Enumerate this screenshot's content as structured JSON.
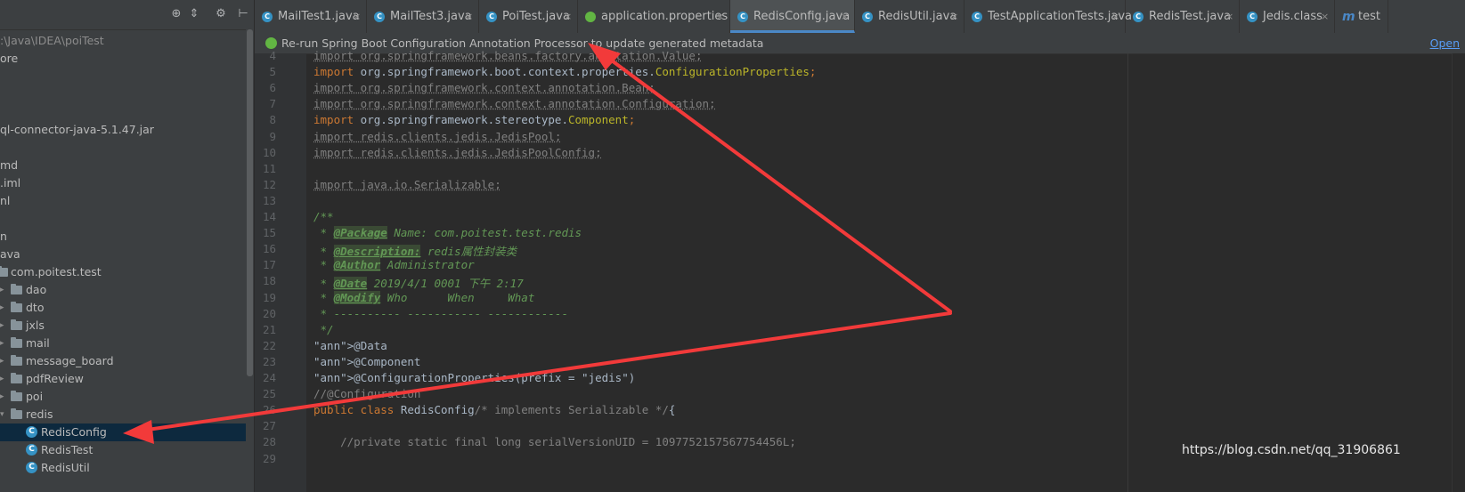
{
  "sidebar": {
    "toolbar_icons": [
      "target-icon",
      "collapse-icon",
      "gear-icon",
      "hide-icon"
    ],
    "items": [
      {
        "label": ":\\Java\\IDEA\\poiTest",
        "kind": "path"
      },
      {
        "label": "ore",
        "kind": "text"
      },
      {
        "label": "",
        "kind": "text"
      },
      {
        "label": "",
        "kind": "text"
      },
      {
        "label": "",
        "kind": "text"
      },
      {
        "label": "ql-connector-java-5.1.47.jar",
        "kind": "text"
      },
      {
        "label": "",
        "kind": "text"
      },
      {
        "label": "md",
        "kind": "text"
      },
      {
        "label": ".iml",
        "kind": "text"
      },
      {
        "label": "nl",
        "kind": "text"
      },
      {
        "label": "",
        "kind": "text"
      },
      {
        "label": "n",
        "kind": "text"
      },
      {
        "label": "ava",
        "kind": "text"
      },
      {
        "label": "com.poitest.test",
        "kind": "package"
      },
      {
        "label": "dao",
        "kind": "folder"
      },
      {
        "label": "dto",
        "kind": "folder"
      },
      {
        "label": "jxls",
        "kind": "folder"
      },
      {
        "label": "mail",
        "kind": "folder"
      },
      {
        "label": "message_board",
        "kind": "folder"
      },
      {
        "label": "pdfReview",
        "kind": "folder"
      },
      {
        "label": "poi",
        "kind": "folder"
      },
      {
        "label": "redis",
        "kind": "folder-open"
      },
      {
        "label": "RedisConfig",
        "kind": "class",
        "selected": true
      },
      {
        "label": "RedisTest",
        "kind": "class"
      },
      {
        "label": "RedisUtil",
        "kind": "class"
      }
    ]
  },
  "tabs": [
    {
      "label": "MailTest1.java",
      "icon": "class-icon"
    },
    {
      "label": "MailTest3.java",
      "icon": "class-icon"
    },
    {
      "label": "PoiTest.java",
      "icon": "class-icon"
    },
    {
      "label": "application.properties",
      "icon": "spring-icon"
    },
    {
      "label": "RedisConfig.java",
      "icon": "class-icon",
      "active": true
    },
    {
      "label": "RedisUtil.java",
      "icon": "class-icon"
    },
    {
      "label": "TestApplicationTests.java",
      "icon": "class-icon"
    },
    {
      "label": "RedisTest.java",
      "icon": "class-icon"
    },
    {
      "label": "Jedis.class",
      "icon": "class-icon"
    },
    {
      "label": "test",
      "icon": "m-icon"
    }
  ],
  "notice": {
    "text": "Re-run Spring Boot Configuration Annotation Processor to update generated metadata",
    "link": "Open"
  },
  "editor": {
    "line_numbers": [
      "4",
      "5",
      "6",
      "7",
      "8",
      "9",
      "10",
      "11",
      "12",
      "13",
      "14",
      "15",
      "16",
      "17",
      "18",
      "19",
      "20",
      "21",
      "22",
      "23",
      "24",
      "25",
      "26",
      "27",
      "28",
      "29"
    ],
    "lines": [
      "import org.springframework.beans.factory.annotation.Value;",
      "import org.springframework.boot.context.properties.ConfigurationProperties;",
      "import org.springframework.context.annotation.Bean;",
      "import org.springframework.context.annotation.Configuration;",
      "import org.springframework.stereotype.Component;",
      "import redis.clients.jedis.JedisPool;",
      "import redis.clients.jedis.JedisPoolConfig;",
      "",
      "import java.io.Serializable;",
      "",
      "/**",
      " * @Package Name: com.poitest.test.redis",
      " * @Description: redis属性封装类",
      " * @Author Administrator",
      " * @Date 2019/4/1 0001 下午 2:17",
      " * @Modify Who      When     What",
      " * ---------- ----------- ------------",
      " */",
      "@Data",
      "@Component",
      "@ConfigurationProperties(prefix = \"jedis\")",
      "//@Configuration",
      "public class RedisConfig/* implements Serializable */{",
      "",
      "    //private static final long serialVersionUID = 1097752157567754456L;",
      ""
    ]
  },
  "watermark": "https://blog.csdn.net/qq_31906861",
  "colors": {
    "keyword": "#cc7832",
    "annotation": "#bbb529",
    "string": "#6a8759",
    "comment": "#808080",
    "doc": "#629755",
    "arrow": "#f23a3a",
    "selection": "#0d293e"
  }
}
